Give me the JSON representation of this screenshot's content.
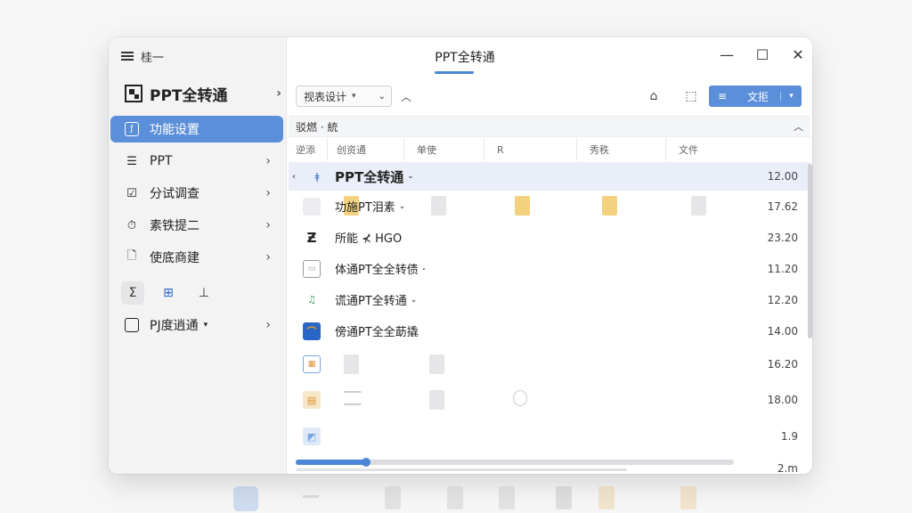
{
  "window": {
    "title": "PPT全转通"
  },
  "sidebar": {
    "menu_label": "桂一",
    "app_title": "PPT全转通",
    "items": [
      {
        "label": "功能设置",
        "icon": "function-icon",
        "active": true
      },
      {
        "label": "PPT",
        "icon": "list-icon",
        "active": false
      },
      {
        "label": "分试调查",
        "icon": "checkbox-icon",
        "active": false
      },
      {
        "label": "素铁提二",
        "icon": "timer-icon",
        "active": false
      },
      {
        "label": "使底商建",
        "icon": "document-icon",
        "active": false
      }
    ],
    "tools": [
      "sigma-icon",
      "chart-icon",
      "chart-alt-icon"
    ],
    "last_item": {
      "label": "PJ度逍通",
      "icon": "calendar-icon"
    }
  },
  "toolbar": {
    "view_select": "视表设计",
    "file_button": "文拒"
  },
  "filter": {
    "label": "驳燃 · 統"
  },
  "columns": [
    "逆添",
    "创资通",
    "单使",
    "R",
    "秀秩",
    "文件"
  ],
  "rows": [
    {
      "name": "PPT全转通",
      "value": "12.00"
    },
    {
      "name": "功施PT泪素",
      "value": "17.62"
    },
    {
      "name": "所能 ⊀ HGO",
      "value": "23.20"
    },
    {
      "name": "体通PT全全转债 ·",
      "value": "11.20"
    },
    {
      "name": "谎通PT全转通",
      "value": "12.20"
    },
    {
      "name": "傍通PT全全莇撬",
      "value": "14.00"
    },
    {
      "name": "",
      "value": "16.20"
    },
    {
      "name": "",
      "value": "18.00"
    },
    {
      "name": "",
      "value": "1.9"
    },
    {
      "name": "",
      "value": "2.m"
    }
  ]
}
